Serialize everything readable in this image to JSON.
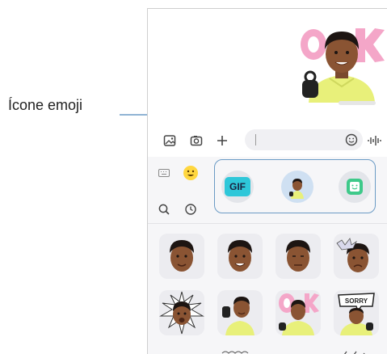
{
  "callout": {
    "label": "Ícone emoji"
  },
  "categories": {
    "gif_label": "GIF"
  },
  "icons": {
    "gallery": "gallery-icon",
    "camera": "camera-icon",
    "add": "plus-icon",
    "emoji": "smiley-icon",
    "voice": "voice-waveform-icon",
    "keyboard": "keyboard-icon",
    "emoji_tab": "emoji-tab-icon",
    "search": "search-icon",
    "recent": "clock-icon",
    "ar_emoji": "ar-emoji-avatar-icon",
    "sticker_app": "sticker-app-icon"
  },
  "colors": {
    "callout_line": "#6b9bc5",
    "category_selected_bg": "#cfe0f2",
    "gif_chip": "#2ec7d9",
    "sticker_app_bg": "#3ec98a",
    "emoji_tab_bg": "#ffd740"
  }
}
